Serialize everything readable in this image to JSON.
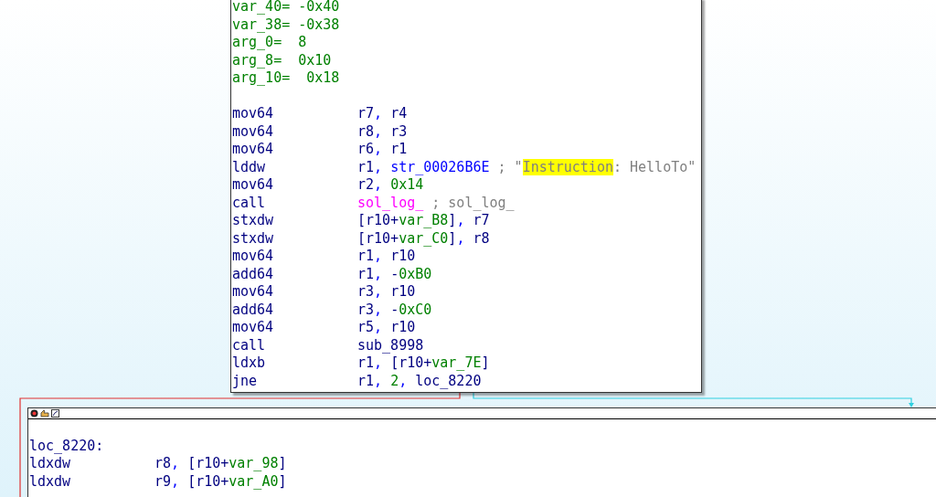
{
  "blocks": [
    {
      "header_icons": false,
      "shadow": true,
      "lines": [
        {
          "kind": "decl",
          "text": "var_40= -0x40"
        },
        {
          "kind": "decl",
          "text": "var_38= -0x38"
        },
        {
          "kind": "decl",
          "text": "arg_0=  8"
        },
        {
          "kind": "decl",
          "text": "arg_8=  0x10"
        },
        {
          "kind": "decl",
          "text": "arg_10=  0x18"
        },
        {
          "kind": "blank"
        },
        {
          "kind": "insn",
          "mnemonic": "mov64",
          "operands": [
            {
              "kind": "reg",
              "text": "r7"
            },
            {
              "kind": "punct",
              "text": ", "
            },
            {
              "kind": "reg",
              "text": "r4"
            }
          ]
        },
        {
          "kind": "insn",
          "mnemonic": "mov64",
          "operands": [
            {
              "kind": "reg",
              "text": "r8"
            },
            {
              "kind": "punct",
              "text": ", "
            },
            {
              "kind": "reg",
              "text": "r3"
            }
          ]
        },
        {
          "kind": "insn",
          "mnemonic": "mov64",
          "operands": [
            {
              "kind": "reg",
              "text": "r6"
            },
            {
              "kind": "punct",
              "text": ", "
            },
            {
              "kind": "reg",
              "text": "r1"
            }
          ]
        },
        {
          "kind": "insn",
          "mnemonic": "lddw",
          "operands": [
            {
              "kind": "reg",
              "text": "r1"
            },
            {
              "kind": "punct",
              "text": ", "
            },
            {
              "kind": "sym",
              "text": "str_00026B6E"
            },
            {
              "kind": "comment",
              "text": " ; \""
            },
            {
              "kind": "highlight",
              "text": "Instruction"
            },
            {
              "kind": "comment",
              "text": ": HelloTo\""
            }
          ]
        },
        {
          "kind": "insn",
          "mnemonic": "mov64",
          "operands": [
            {
              "kind": "reg",
              "text": "r2"
            },
            {
              "kind": "punct",
              "text": ", "
            },
            {
              "kind": "num",
              "text": "0x14"
            }
          ]
        },
        {
          "kind": "insn",
          "mnemonic": "call",
          "operands": [
            {
              "kind": "func",
              "text": "sol_log_"
            },
            {
              "kind": "comment",
              "text": " ; sol_log_"
            }
          ]
        },
        {
          "kind": "insn",
          "mnemonic": "stxdw",
          "operands": [
            {
              "kind": "reg",
              "text": "[r10+"
            },
            {
              "kind": "num",
              "text": "var_B8"
            },
            {
              "kind": "reg",
              "text": "]"
            },
            {
              "kind": "punct",
              "text": ", "
            },
            {
              "kind": "reg",
              "text": "r7"
            }
          ]
        },
        {
          "kind": "insn",
          "mnemonic": "stxdw",
          "operands": [
            {
              "kind": "reg",
              "text": "[r10+"
            },
            {
              "kind": "num",
              "text": "var_C0"
            },
            {
              "kind": "reg",
              "text": "]"
            },
            {
              "kind": "punct",
              "text": ", "
            },
            {
              "kind": "reg",
              "text": "r8"
            }
          ]
        },
        {
          "kind": "insn",
          "mnemonic": "mov64",
          "operands": [
            {
              "kind": "reg",
              "text": "r1"
            },
            {
              "kind": "punct",
              "text": ", "
            },
            {
              "kind": "reg",
              "text": "r10"
            }
          ]
        },
        {
          "kind": "insn",
          "mnemonic": "add64",
          "operands": [
            {
              "kind": "reg",
              "text": "r1"
            },
            {
              "kind": "punct",
              "text": ", "
            },
            {
              "kind": "reg",
              "text": "-"
            },
            {
              "kind": "num",
              "text": "0xB0"
            }
          ]
        },
        {
          "kind": "insn",
          "mnemonic": "mov64",
          "operands": [
            {
              "kind": "reg",
              "text": "r3"
            },
            {
              "kind": "punct",
              "text": ", "
            },
            {
              "kind": "reg",
              "text": "r10"
            }
          ]
        },
        {
          "kind": "insn",
          "mnemonic": "add64",
          "operands": [
            {
              "kind": "reg",
              "text": "r3"
            },
            {
              "kind": "punct",
              "text": ", "
            },
            {
              "kind": "reg",
              "text": "-"
            },
            {
              "kind": "num",
              "text": "0xC0"
            }
          ]
        },
        {
          "kind": "insn",
          "mnemonic": "mov64",
          "operands": [
            {
              "kind": "reg",
              "text": "r5"
            },
            {
              "kind": "punct",
              "text": ", "
            },
            {
              "kind": "reg",
              "text": "r10"
            }
          ]
        },
        {
          "kind": "insn",
          "mnemonic": "call",
          "operands": [
            {
              "kind": "reg",
              "text": "sub_8998"
            }
          ]
        },
        {
          "kind": "insn",
          "mnemonic": "ldxb",
          "operands": [
            {
              "kind": "reg",
              "text": "r1"
            },
            {
              "kind": "punct",
              "text": ", "
            },
            {
              "kind": "reg",
              "text": "[r10+"
            },
            {
              "kind": "num",
              "text": "var_7E"
            },
            {
              "kind": "reg",
              "text": "]"
            }
          ]
        },
        {
          "kind": "insn",
          "mnemonic": "jne",
          "operands": [
            {
              "kind": "reg",
              "text": "r1"
            },
            {
              "kind": "punct",
              "text": ", "
            },
            {
              "kind": "num",
              "text": "2"
            },
            {
              "kind": "punct",
              "text": ", "
            },
            {
              "kind": "reg",
              "text": "loc_8220"
            }
          ]
        }
      ]
    },
    {
      "header_icons": true,
      "shadow": false,
      "lines": [
        {
          "kind": "blank"
        },
        {
          "kind": "label",
          "text": "loc_8220:"
        },
        {
          "kind": "insn",
          "mnemonic": "ldxdw",
          "operands": [
            {
              "kind": "reg",
              "text": "r8"
            },
            {
              "kind": "punct",
              "text": ", "
            },
            {
              "kind": "reg",
              "text": "[r10+"
            },
            {
              "kind": "num",
              "text": "var_98"
            },
            {
              "kind": "reg",
              "text": "]"
            }
          ]
        },
        {
          "kind": "insn",
          "mnemonic": "ldxdw",
          "operands": [
            {
              "kind": "reg",
              "text": "r9"
            },
            {
              "kind": "punct",
              "text": ", "
            },
            {
              "kind": "reg",
              "text": "[r10+"
            },
            {
              "kind": "num",
              "text": "var_A0"
            },
            {
              "kind": "reg",
              "text": "]"
            }
          ]
        }
      ]
    }
  ]
}
